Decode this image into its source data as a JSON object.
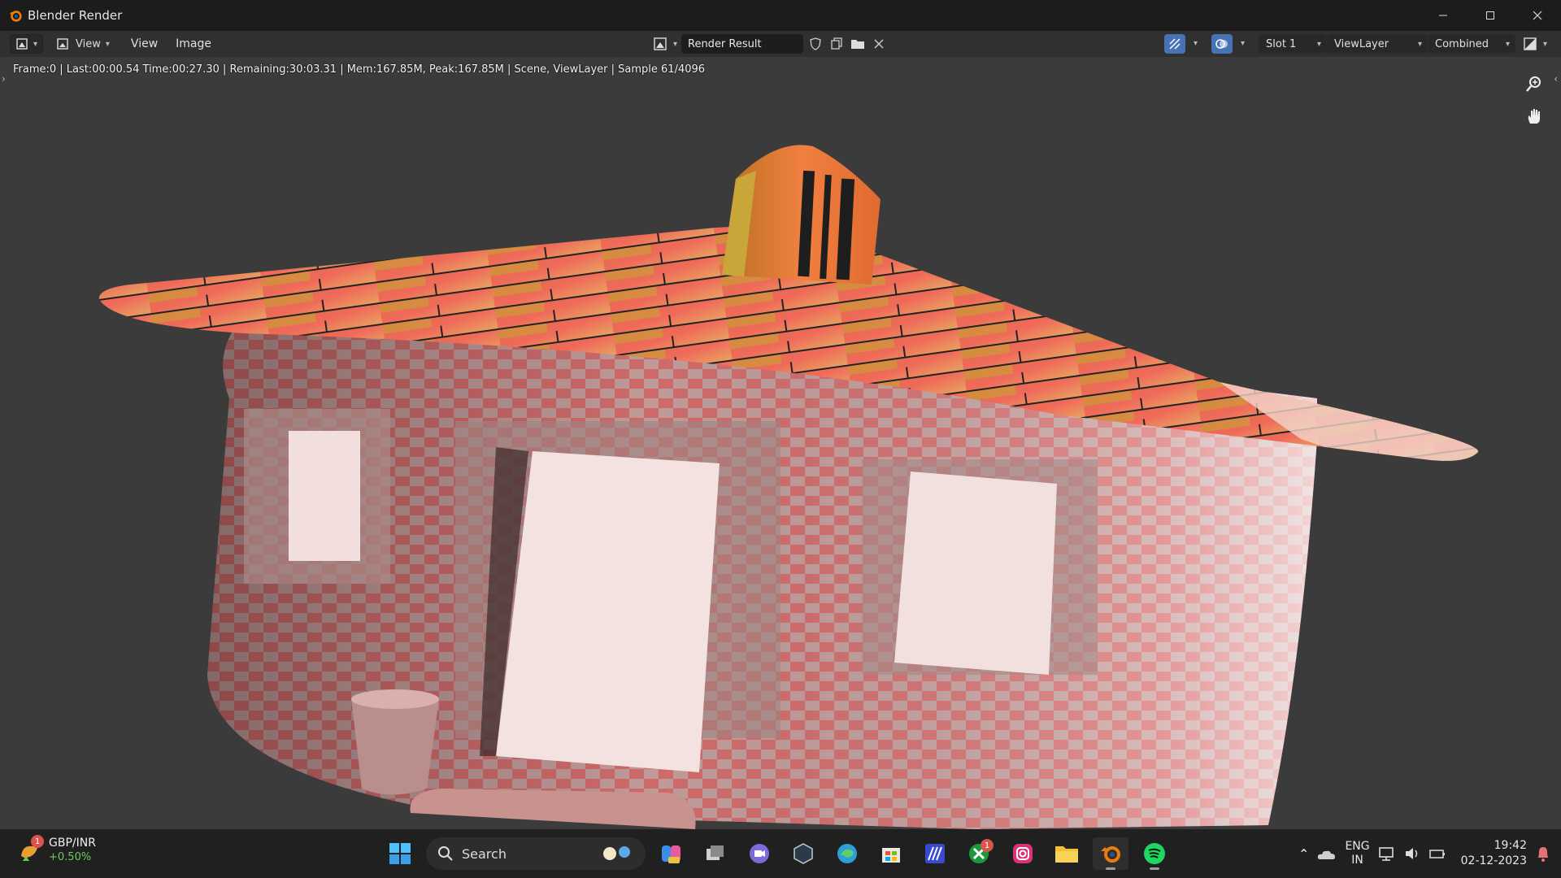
{
  "window": {
    "title": "Blender Render",
    "controls": [
      "minimize",
      "maximize",
      "close"
    ]
  },
  "header": {
    "view_menu_label": "View",
    "menu": [
      "View",
      "Image"
    ],
    "image_name": "Render Result",
    "slot": "Slot 1",
    "view_layer": "ViewLayer",
    "pass": "Combined"
  },
  "viewport": {
    "stats": "Frame:0 | Last:00:00.54 Time:00:27.30 | Remaining:30:03.31 | Mem:167.85M, Peak:167.85M | Scene, ViewLayer | Sample 61/4096",
    "tools": [
      "zoom-icon",
      "hand-icon"
    ]
  },
  "taskbar": {
    "widget": {
      "symbol": "GBP/INR",
      "change": "+0.50%",
      "badge": "1"
    },
    "search_label": "Search",
    "apps": [
      "start",
      "search",
      "copilot",
      "task-view",
      "zoom",
      "obs",
      "edge",
      "store",
      "app",
      "xbox",
      "instagram",
      "files",
      "blender",
      "spotify"
    ],
    "xbox_badge": "1",
    "language": {
      "line1": "ENG",
      "line2": "IN"
    },
    "clock": {
      "time": "19:42",
      "date": "02-12-2023"
    }
  },
  "colors": {
    "accent": "#4772b3",
    "titlebar": "#1c1c1c",
    "header": "#303030",
    "viewport": "#3b3b3b",
    "taskbar": "#202020"
  }
}
